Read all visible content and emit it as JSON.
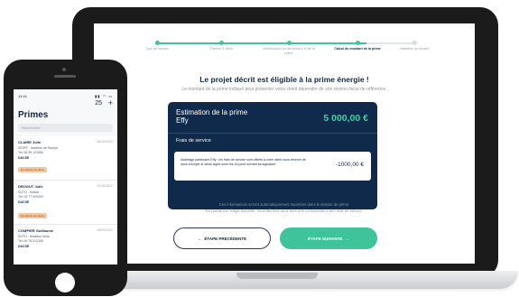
{
  "stepper": {
    "steps": [
      {
        "label": "Type de travaux"
      },
      {
        "label": "Chantier & devis"
      },
      {
        "label": "Identification du demandeur et de la prime"
      },
      {
        "label": "Calcul du montant de la prime"
      },
      {
        "label": "Validation du dossier"
      }
    ]
  },
  "main": {
    "title": "Le projet décrit est éligible à la prime énergie !",
    "subtitle": "Le montant de la prime indiqué peut présenter votre client dépendre de son revenu fiscal de référence.",
    "estimate_label": "Estimation de la prime Effy",
    "estimate_amount": "5 000,00 €",
    "fees_label": "Frais de service",
    "discount_text": "Avantage partenaire Effy : les frais de service sont offerts à votre client sous réserve de nous envoyer le devis signé sous les 15 jours suivant sa signature",
    "discount_amount": "-1000,00 €",
    "footnote_line1": "Ces informations seront automatiquement reportées dans le dossier de prime.",
    "footnote_line2": "En passant à l'étape suivante, vous affirmez avoir bien pris connaissance des frais de service.",
    "prev_button": "ÉTAPE PRÉCÉDENTE",
    "prev_arrow": "←",
    "next_button": "ÉTAPE SUIVANTE",
    "next_arrow": "→"
  },
  "phone": {
    "time": "14:41",
    "status_icons": "▮▮ ◠ ▭",
    "title": "Primes",
    "count": "25",
    "plus": "+",
    "search_placeholder": "Rechercher",
    "items": [
      {
        "name": "CLAIRE Julie",
        "date": "05/10/2021",
        "line1": "ISOPE - Isolation de Rampe",
        "line2": "Tel: 06 55 123456",
        "status": "DACSE",
        "tag": "En attente du devis"
      },
      {
        "name": "DROGUT Julie",
        "date": "01/10/2021",
        "line1": "SOTO - Isolian",
        "line2": "Tel: 05 77 000000",
        "status": "DACSE",
        "tag": "En attente du devis"
      },
      {
        "name": "COMPIER Guillaume",
        "date": "28/09/2021",
        "line1": "SOTO - Isolation Murs",
        "line2": "Tel: 06 78 012345",
        "status": "DACSE",
        "tag": ""
      }
    ]
  }
}
